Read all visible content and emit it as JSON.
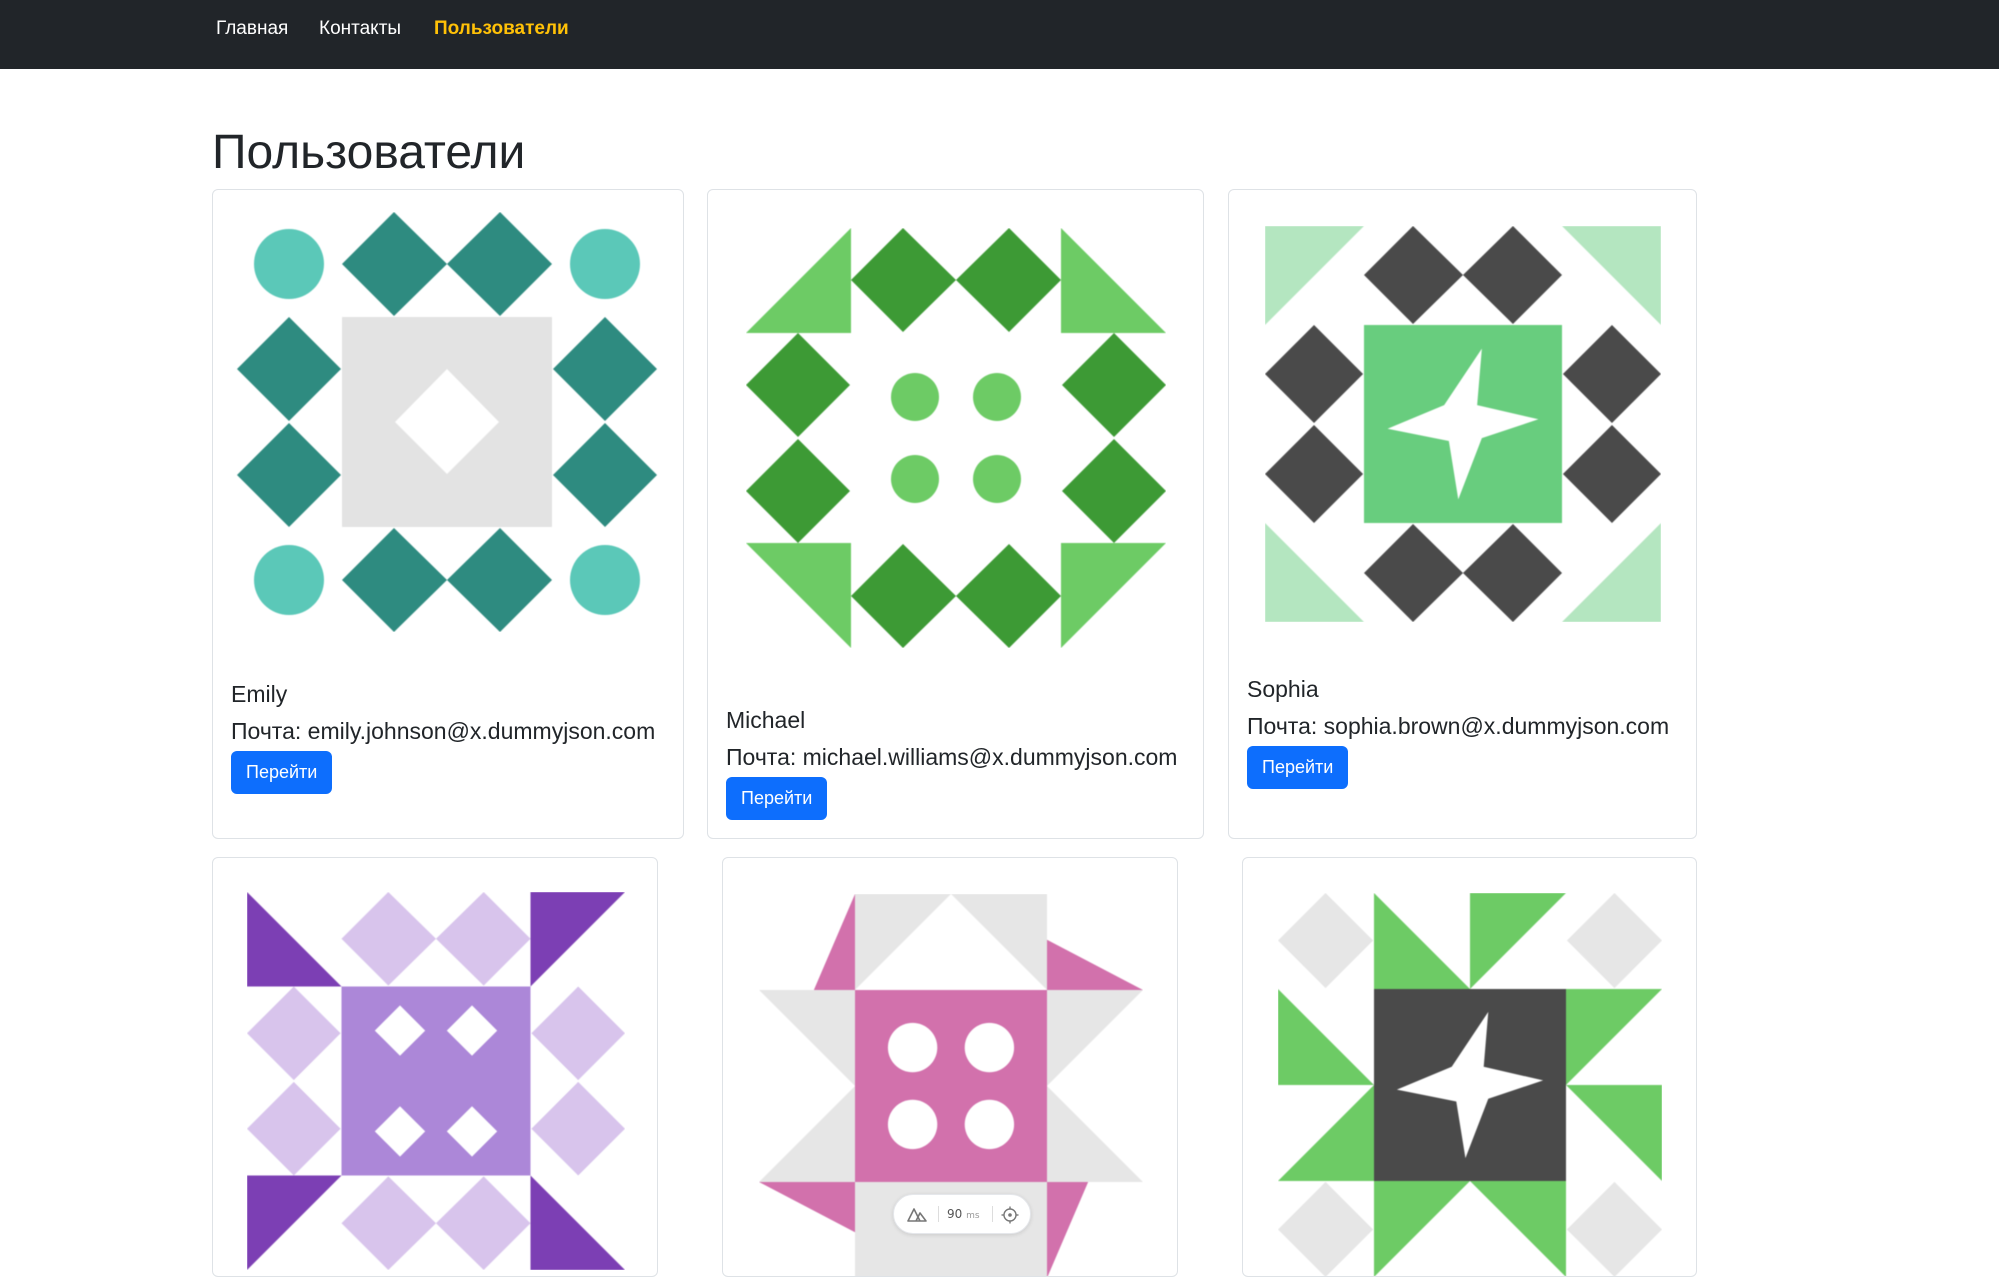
{
  "nav": {
    "items": [
      {
        "label": "Главная",
        "active": false
      },
      {
        "label": "Контакты",
        "active": false
      },
      {
        "label": "Пользователи",
        "active": true
      }
    ],
    "active_color": "#ffc107",
    "background": "#212529"
  },
  "page": {
    "title": "Пользователи"
  },
  "users": [
    {
      "name": "Emily",
      "email": "Почта: emily.johnson@x.dummyjson.com",
      "button": "Перейти",
      "avatar": "identicon-teal-avatar"
    },
    {
      "name": "Michael",
      "email": "Почта: michael.williams@x.dummyjson.com",
      "button": "Перейти",
      "avatar": "identicon-green-avatar"
    },
    {
      "name": "Sophia",
      "email": "Почта: sophia.brown@x.dummyjson.com",
      "button": "Перейти",
      "avatar": "identicon-dark-green-star-avatar"
    },
    {
      "avatar": "identicon-purple-avatar"
    },
    {
      "avatar": "identicon-pink-avatar"
    },
    {
      "avatar": "identicon-dark-star-green-avatar"
    }
  ],
  "dev_toolbar": {
    "render_time": "90",
    "unit": "ms"
  },
  "colors": {
    "button": "#0d6efd",
    "teal": "#2e8b80",
    "teal_light": "#5bc8b8",
    "green": "#3d9a35",
    "green_light": "#6dcb65",
    "dark": "#4a4a4a",
    "mint": "#68cd7e",
    "mint_light": "#b4e6c0",
    "purple": "#7c3fb4",
    "purple_mid": "#ac87d8",
    "purple_light": "#d8c4ec",
    "pink": "#d271ac",
    "gray_light": "#e6e6e6"
  }
}
